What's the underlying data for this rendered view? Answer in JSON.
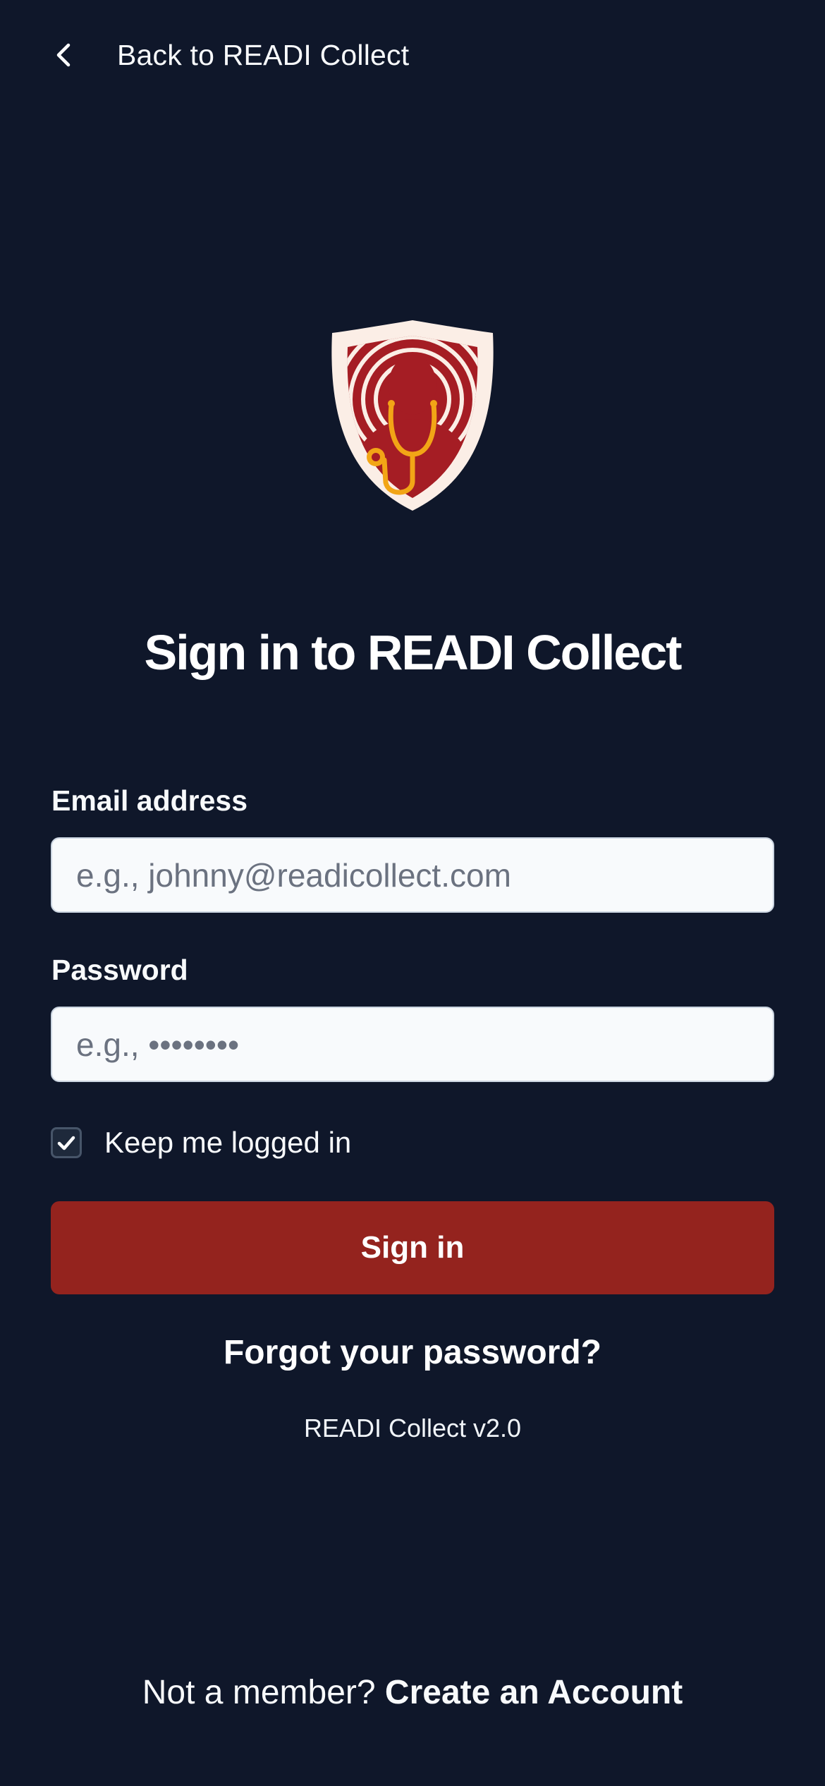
{
  "header": {
    "back_label": "Back to READI Collect",
    "back_icon": "chevron-left-icon"
  },
  "logo": {
    "name": "readi-collect-shield-logo",
    "colors": {
      "shield_outer": "#fbeee6",
      "shield_inner": "#a51d24",
      "stethoscope": "#f2a516"
    }
  },
  "page": {
    "title": "Sign in to READI Collect"
  },
  "form": {
    "email": {
      "label": "Email address",
      "placeholder": "e.g., johnny@readicollect.com",
      "value": ""
    },
    "password": {
      "label": "Password",
      "placeholder": "e.g., ••••••••",
      "value": ""
    },
    "remember": {
      "label": "Keep me logged in",
      "checked": true
    },
    "submit_label": "Sign in"
  },
  "links": {
    "forgot_password": "Forgot your password?"
  },
  "version": "READI Collect v2.0",
  "footer": {
    "prompt": "Not a member?",
    "create_account": "Create an Account"
  },
  "colors": {
    "background": "#0f172a",
    "primary_button": "#94231e",
    "input_background": "#f8fafc",
    "text": "#ffffff"
  }
}
